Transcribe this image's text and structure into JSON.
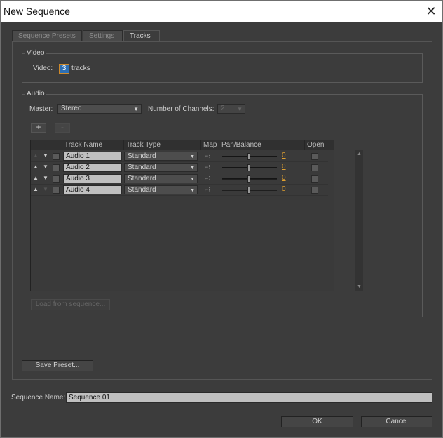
{
  "window": {
    "title": "New Sequence",
    "close_glyph": "✕"
  },
  "tabs": [
    {
      "label": "Sequence Presets"
    },
    {
      "label": "Settings"
    },
    {
      "label": "Tracks"
    }
  ],
  "video": {
    "group_label": "Video",
    "field_label": "Video:",
    "count": "3",
    "unit": "tracks"
  },
  "audio": {
    "group_label": "Audio",
    "master_label": "Master:",
    "master_value": "Stereo",
    "channels_label": "Number of Channels:",
    "channels_value": "2",
    "add_label": "+",
    "remove_label": "-",
    "columns": [
      "Track Name",
      "Track Type",
      "Map",
      "Pan/Balance",
      "Open"
    ],
    "tracks": [
      {
        "name": "Audio 1",
        "type": "Standard",
        "pan": "0"
      },
      {
        "name": "Audio 2",
        "type": "Standard",
        "pan": "0"
      },
      {
        "name": "Audio 3",
        "type": "Standard",
        "pan": "0"
      },
      {
        "name": "Audio 4",
        "type": "Standard",
        "pan": "0"
      }
    ],
    "load_label": "Load from sequence..."
  },
  "footer": {
    "save_preset_label": "Save Preset...",
    "sequence_name_label": "Sequence Name:",
    "sequence_name_value": "Sequence 01",
    "ok_label": "OK",
    "cancel_label": "Cancel"
  }
}
